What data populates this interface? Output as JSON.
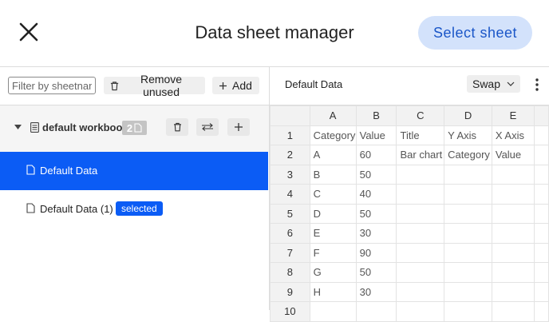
{
  "header": {
    "title": "Data sheet manager",
    "select_sheet": "Select sheet"
  },
  "left_toolbar": {
    "filter_placeholder": "Filter by sheetname",
    "remove_unused": "Remove unused",
    "add": "Add"
  },
  "workbook": {
    "name": "default workbook",
    "sheet_count": "2"
  },
  "sheets": [
    {
      "label": "Default Data",
      "active": true
    },
    {
      "label": "Default Data (1)",
      "badge": "selected"
    }
  ],
  "right_toolbar": {
    "sheet_title": "Default Data",
    "swap": "Swap"
  },
  "grid": {
    "columns": [
      "A",
      "B",
      "C",
      "D",
      "E"
    ],
    "rows": [
      {
        "num": "1",
        "cells": [
          "Category",
          "Value",
          "Title",
          "Y Axis",
          "X Axis"
        ]
      },
      {
        "num": "2",
        "cells": [
          "A",
          "60",
          "Bar chart",
          "Category",
          "Value"
        ]
      },
      {
        "num": "3",
        "cells": [
          "B",
          "50",
          "",
          "",
          ""
        ]
      },
      {
        "num": "4",
        "cells": [
          "C",
          "40",
          "",
          "",
          ""
        ]
      },
      {
        "num": "5",
        "cells": [
          "D",
          "50",
          "",
          "",
          ""
        ]
      },
      {
        "num": "6",
        "cells": [
          "E",
          "30",
          "",
          "",
          ""
        ]
      },
      {
        "num": "7",
        "cells": [
          "F",
          "90",
          "",
          "",
          ""
        ]
      },
      {
        "num": "8",
        "cells": [
          "G",
          "50",
          "",
          "",
          ""
        ]
      },
      {
        "num": "9",
        "cells": [
          "H",
          "30",
          "",
          "",
          ""
        ]
      },
      {
        "num": "10",
        "cells": [
          "",
          "",
          "",
          "",
          ""
        ]
      }
    ]
  },
  "colors": {
    "accent": "#0b5cf5",
    "select_button_bg": "#d3e2fb",
    "select_button_text": "#1a56c8"
  }
}
